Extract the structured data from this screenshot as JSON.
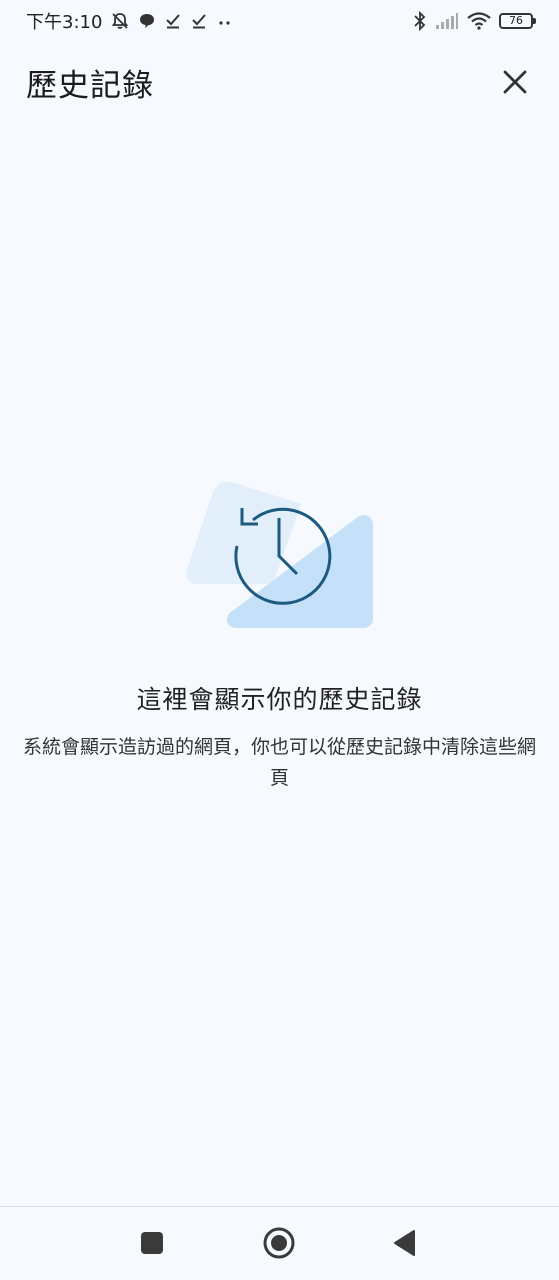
{
  "status_bar": {
    "time": "下午3:10",
    "left_icons": [
      "bell-off-icon",
      "chat-bubble-icon",
      "download-done-icon",
      "download-done-icon",
      "more-dots-icon"
    ],
    "right_icons": [
      "bluetooth-icon",
      "signal-icon",
      "wifi-icon"
    ],
    "battery_level": "76"
  },
  "app_bar": {
    "title": "歷史記錄",
    "close_icon": "close-icon"
  },
  "empty_state": {
    "illustration_icon": "history-clock-icon",
    "title": "這裡會顯示你的歷史記錄",
    "description": "系統會顯示造訪過的網頁，你也可以從歷史記錄中清除這些網頁"
  },
  "nav_bar": {
    "buttons": [
      "recents-square-icon",
      "home-circle-icon",
      "back-triangle-icon"
    ]
  },
  "colors": {
    "background": "#f6f9fd",
    "illustration_light": "#e2eef9",
    "illustration_blue": "#c5e1f9",
    "clock_stroke": "#1d5a80"
  }
}
